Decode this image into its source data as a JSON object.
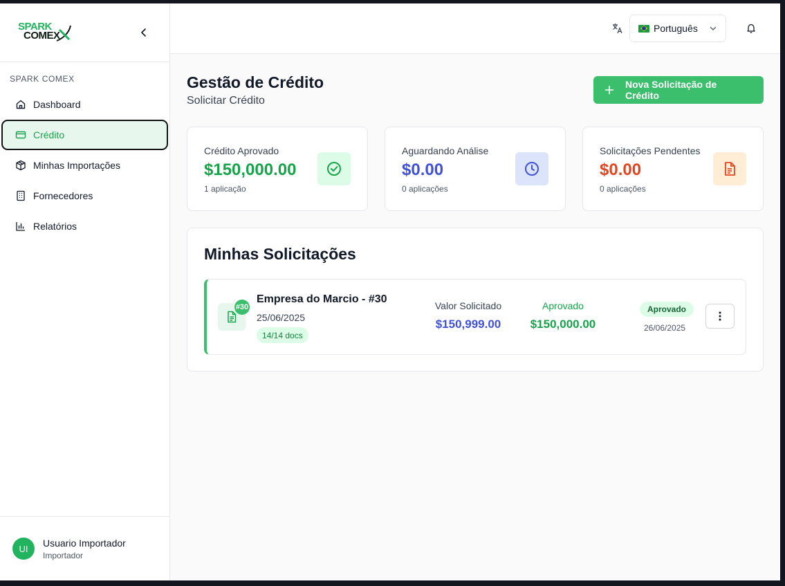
{
  "colors": {
    "brand_green": "#3cbf6c",
    "approved_green": "#16a34a",
    "analysis_blue": "#4051d6",
    "pending_orange": "#e0461f"
  },
  "sidebar": {
    "logo": {
      "line1": "SPARK",
      "line2": "COMEX"
    },
    "collapse_icon": "chevron-left-icon",
    "section_label": "SPARK COMEX",
    "items": [
      {
        "label": "Dashboard",
        "icon": "home-icon",
        "active": false
      },
      {
        "label": "Crédito",
        "icon": "credit-card-icon",
        "active": true
      },
      {
        "label": "Minhas Importações",
        "icon": "package-icon",
        "active": false
      },
      {
        "label": "Fornecedores",
        "icon": "building-icon",
        "active": false
      },
      {
        "label": "Relatórios",
        "icon": "bar-chart-icon",
        "active": false
      }
    ],
    "user": {
      "initials": "UI",
      "name": "Usuario Importador",
      "role": "Importador"
    }
  },
  "topbar": {
    "language_icon": "translate-icon",
    "language": "Português",
    "notification_icon": "bell-icon"
  },
  "page": {
    "title": "Gestão de Crédito",
    "subtitle": "Solicitar Crédito",
    "new_request_button": "Nova Solicitação de Crédito"
  },
  "stats": [
    {
      "label": "Crédito Aprovado",
      "value": "$150,000.00",
      "sub": "1 aplicação",
      "color": "#16a34a",
      "icon": "check-circle-icon"
    },
    {
      "label": "Aguardando Análise",
      "value": "$0.00",
      "sub": "0 aplicações",
      "color": "#4051d6",
      "icon": "clock-icon"
    },
    {
      "label": "Solicitações Pendentes",
      "value": "$0.00",
      "sub": "0 aplicações",
      "color": "#e0461f",
      "icon": "document-icon"
    }
  ],
  "requests": {
    "title": "Minhas Solicitações",
    "items": [
      {
        "badge": "#30",
        "company": "Empresa do Marcio - #30",
        "date": "25/06/2025",
        "docs": "14/14 docs",
        "requested_label": "Valor Solicitado",
        "requested_value": "$150,999.00",
        "approved_label": "Aprovado",
        "approved_value": "$150,000.00",
        "status": "Aprovado",
        "status_date": "26/06/2025"
      }
    ]
  }
}
